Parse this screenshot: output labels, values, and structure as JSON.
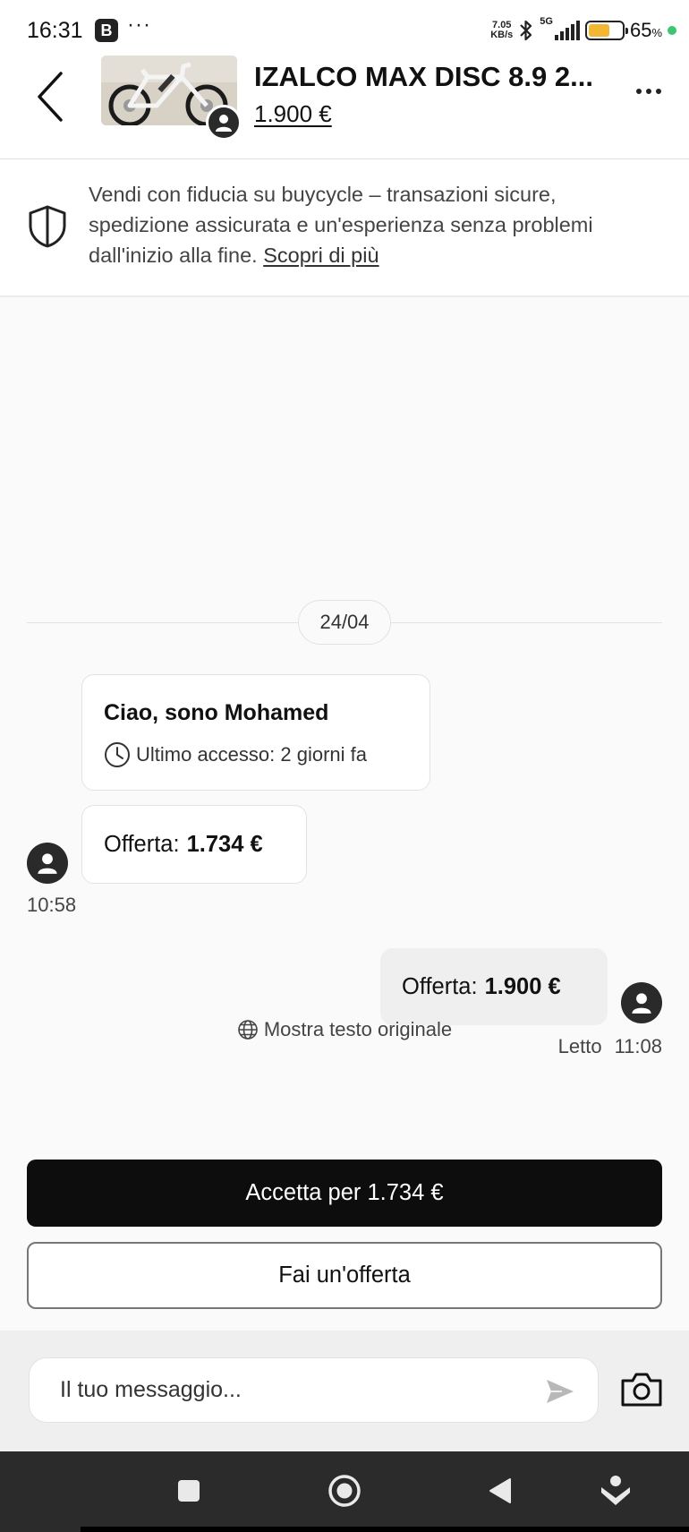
{
  "status_bar": {
    "time": "16:31",
    "app_badge": "B",
    "dots": "···",
    "net_speed_value": "7.05",
    "net_speed_unit": "KB/s",
    "network_type": "5G",
    "battery_level": 0.65,
    "battery_percent": "65",
    "battery_unit": "%",
    "battery_fill_color": "#f2b733",
    "dot_color": "#3ec66e"
  },
  "header": {
    "title": "IZALCO MAX DISC 8.9 2...",
    "price": "1.900 €"
  },
  "trust_banner": {
    "text": "Vendi con fiducia su buycycle – transazioni sicure, spedizione assicurata e un'esperienza senza problemi dall'inizio alla fine.",
    "link": "Scopri di più"
  },
  "chat": {
    "date": "24/04",
    "intro": {
      "name": "Ciao, sono Mohamed",
      "last_seen": "Ultimo accesso: 2 giorni fa"
    },
    "incoming_offer": {
      "label": "Offerta:",
      "amount": "1.734 €",
      "time": "10:58"
    },
    "outgoing_offer": {
      "label": "Offerta:",
      "amount": "1.900 €",
      "status": "Letto",
      "time": "11:08"
    },
    "show_original": "Mostra testo originale"
  },
  "actions": {
    "accept_label": "Accetta per 1.734 €",
    "offer_label": "Fai un'offerta"
  },
  "composer": {
    "placeholder": "Il tuo messaggio..."
  },
  "icons": {
    "back": "chevron-left-icon",
    "more": "more-horizontal-icon",
    "shield": "shield-icon",
    "clock": "clock-icon",
    "globe": "globe-icon",
    "send": "send-icon",
    "camera": "camera-icon",
    "user": "user-icon"
  }
}
